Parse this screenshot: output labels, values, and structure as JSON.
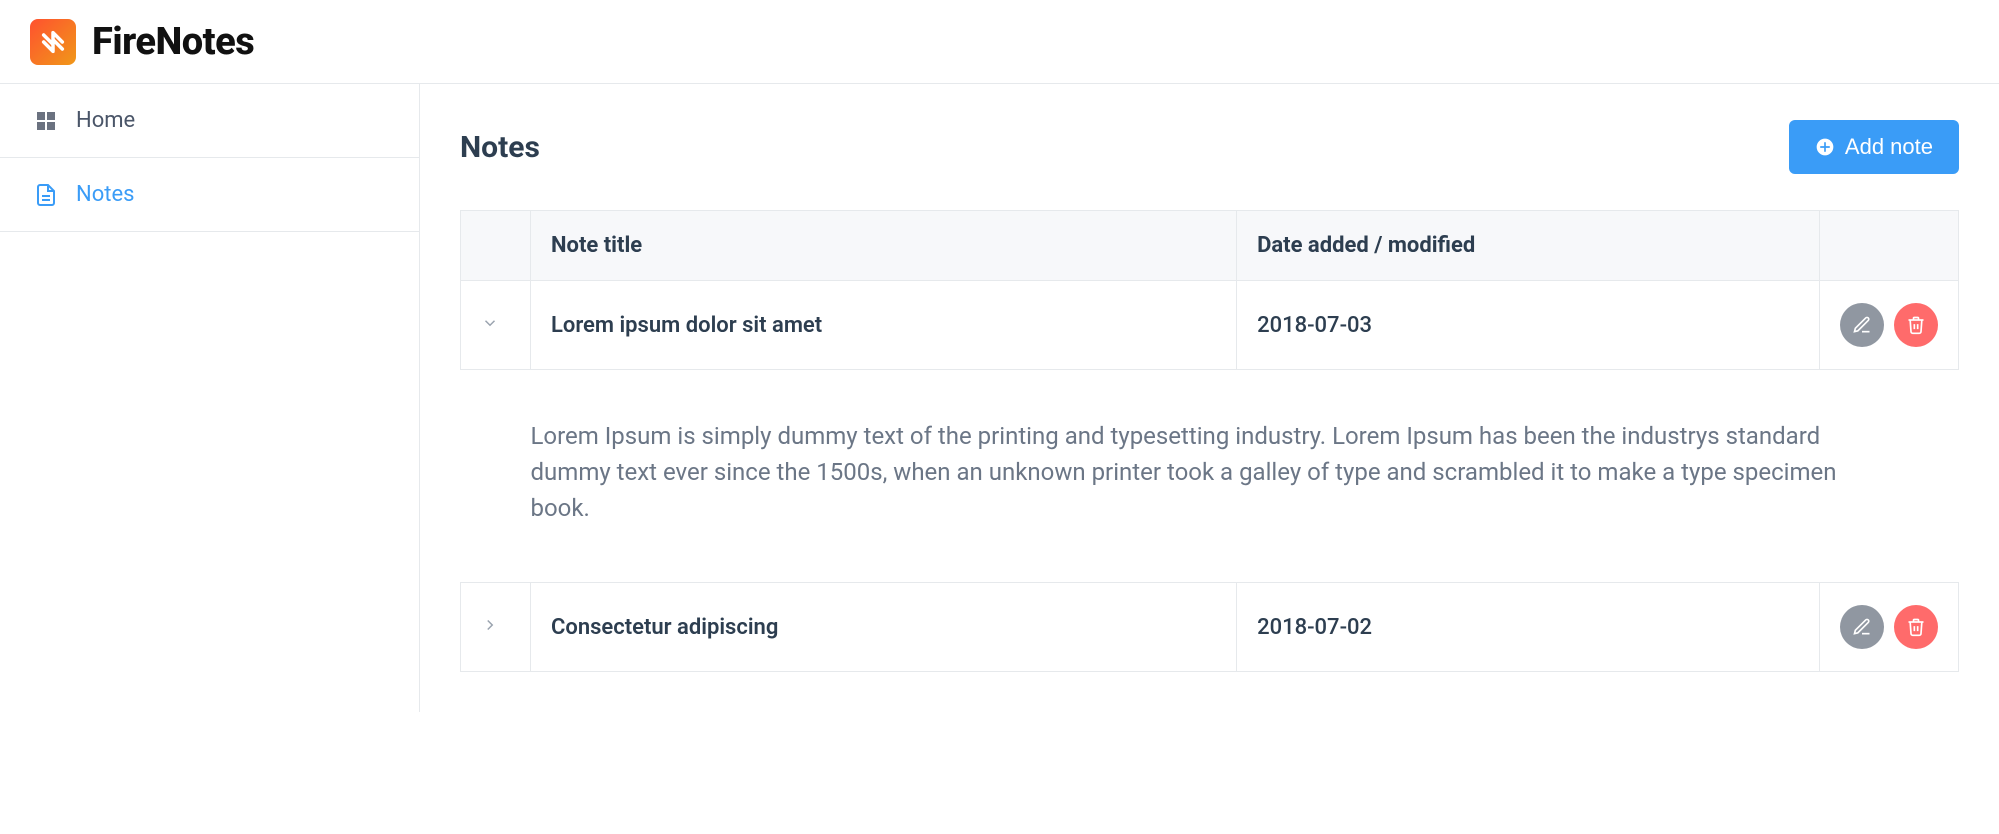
{
  "app": {
    "title": "FireNotes"
  },
  "sidebar": {
    "items": [
      {
        "label": "Home"
      },
      {
        "label": "Notes"
      }
    ]
  },
  "page": {
    "title": "Notes",
    "add_button": "Add note"
  },
  "table": {
    "columns": {
      "title": "Note title",
      "date": "Date added / modified"
    },
    "rows": [
      {
        "title": "Lorem ipsum dolor sit amet",
        "date": "2018-07-03",
        "expanded": true,
        "body": "Lorem Ipsum is simply dummy text of the printing and typesetting industry. Lorem Ipsum has been the industrys standard dummy text ever since the 1500s, when an unknown printer took a galley of type and scrambled it to make a type specimen book."
      },
      {
        "title": "Consectetur adipiscing",
        "date": "2018-07-02",
        "expanded": false
      }
    ]
  }
}
